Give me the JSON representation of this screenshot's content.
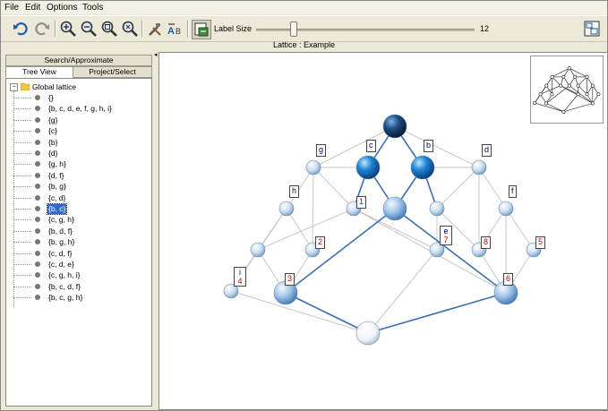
{
  "menu": [
    "File",
    "Edit",
    "Options",
    "Tools"
  ],
  "toolbar": {
    "icons": [
      "undo-icon",
      "redo-icon",
      "zoom-in-icon",
      "zoom-out-icon",
      "zoom-fit-icon",
      "zoom-reset-icon",
      "tools-icon",
      "label-ab-icon",
      "export-icon"
    ],
    "label_size_text": "Label Size",
    "label_size_value": "12",
    "label_size_fraction": 0.17
  },
  "lattice_title": "Lattice : Example",
  "left_panel": {
    "top_tab": "Search/Approximate",
    "tabs": [
      "Tree View",
      "Project/Select"
    ],
    "active_tab": "Tree View",
    "root_label": "Global lattice",
    "root_expander": "−",
    "items": [
      "{}",
      "{b, c, d, e, f, g, h, i}",
      "{g}",
      "{c}",
      "{b}",
      "{d}",
      "{g, h}",
      "{d, f}",
      "{b, g}",
      "{c, d}",
      "{b, c}",
      "{c, g, h}",
      "{b, d, f}",
      "{b, g, h}",
      "{c, d, f}",
      "{c, d, e}",
      "{c, g, h, i}",
      "{b, c, d, f}",
      "{b, c, g, h}"
    ],
    "selected_item": "{b, c}"
  },
  "lattice": {
    "labels_attributes": [
      "g",
      "c",
      "b",
      "d",
      "h",
      "f",
      "e",
      "i"
    ],
    "labels_objects": [
      "1",
      "2",
      "7",
      "8",
      "5",
      "3",
      "6",
      "4"
    ]
  },
  "colors": {
    "selection": "#316ac5",
    "edge_highlight": "#3b6fb3",
    "edge_plain": "#c7c7c7",
    "label_blue": "#000060",
    "label_red": "#cc0000"
  }
}
